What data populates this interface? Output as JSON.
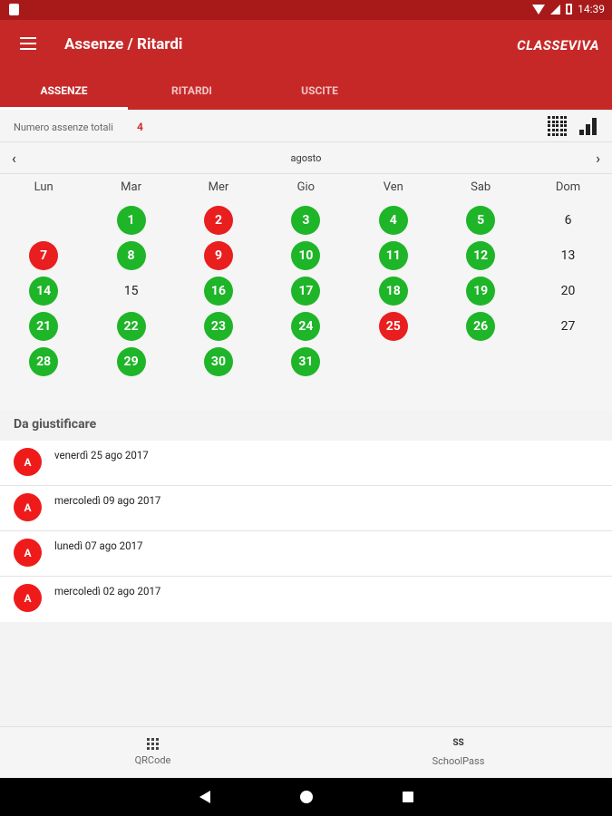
{
  "status_bar": {
    "time": "14:39"
  },
  "app_bar": {
    "title": "Assenze / Ritardi",
    "logo": "CLASSEVIVA"
  },
  "tabs": [
    {
      "label": "ASSENZE",
      "active": true
    },
    {
      "label": "RITARDI",
      "active": false
    },
    {
      "label": "USCITE",
      "active": false
    }
  ],
  "summary": {
    "label": "Numero assenze totali",
    "count": "4"
  },
  "calendar": {
    "month": "agosto",
    "weekdays": [
      "Lun",
      "Mar",
      "Mer",
      "Gio",
      "Ven",
      "Sab",
      "Dom"
    ],
    "weeks": [
      [
        {
          "d": "",
          "s": "none"
        },
        {
          "d": "1",
          "s": "green"
        },
        {
          "d": "2",
          "s": "red"
        },
        {
          "d": "3",
          "s": "green"
        },
        {
          "d": "4",
          "s": "green"
        },
        {
          "d": "5",
          "s": "green"
        },
        {
          "d": "6",
          "s": "plain"
        }
      ],
      [
        {
          "d": "7",
          "s": "red"
        },
        {
          "d": "8",
          "s": "green"
        },
        {
          "d": "9",
          "s": "red"
        },
        {
          "d": "10",
          "s": "green"
        },
        {
          "d": "11",
          "s": "green"
        },
        {
          "d": "12",
          "s": "green"
        },
        {
          "d": "13",
          "s": "plain"
        }
      ],
      [
        {
          "d": "14",
          "s": "green"
        },
        {
          "d": "15",
          "s": "plain"
        },
        {
          "d": "16",
          "s": "green"
        },
        {
          "d": "17",
          "s": "green"
        },
        {
          "d": "18",
          "s": "green"
        },
        {
          "d": "19",
          "s": "green"
        },
        {
          "d": "20",
          "s": "plain"
        }
      ],
      [
        {
          "d": "21",
          "s": "green"
        },
        {
          "d": "22",
          "s": "green"
        },
        {
          "d": "23",
          "s": "green"
        },
        {
          "d": "24",
          "s": "green"
        },
        {
          "d": "25",
          "s": "red"
        },
        {
          "d": "26",
          "s": "green"
        },
        {
          "d": "27",
          "s": "plain"
        }
      ],
      [
        {
          "d": "28",
          "s": "green"
        },
        {
          "d": "29",
          "s": "green"
        },
        {
          "d": "30",
          "s": "green"
        },
        {
          "d": "31",
          "s": "green"
        },
        {
          "d": "",
          "s": "none"
        },
        {
          "d": "",
          "s": "none"
        },
        {
          "d": "",
          "s": "none"
        }
      ]
    ]
  },
  "to_justify": {
    "title": "Da giustificare",
    "items": [
      {
        "badge": "A",
        "date": "venerdì 25 ago 2017"
      },
      {
        "badge": "A",
        "date": "mercoledì 09 ago 2017"
      },
      {
        "badge": "A",
        "date": "lunedì 07 ago 2017"
      },
      {
        "badge": "A",
        "date": "mercoledì 02 ago 2017"
      }
    ]
  },
  "bottom_nav": [
    {
      "label": "QRCode",
      "icon": "qrcode-icon"
    },
    {
      "label": "SchoolPass",
      "icon": "schoolpass-icon",
      "icon_text": "SS"
    }
  ],
  "colors": {
    "primary": "#c62828",
    "present": "#1fb528",
    "absent": "#e91e1e"
  }
}
